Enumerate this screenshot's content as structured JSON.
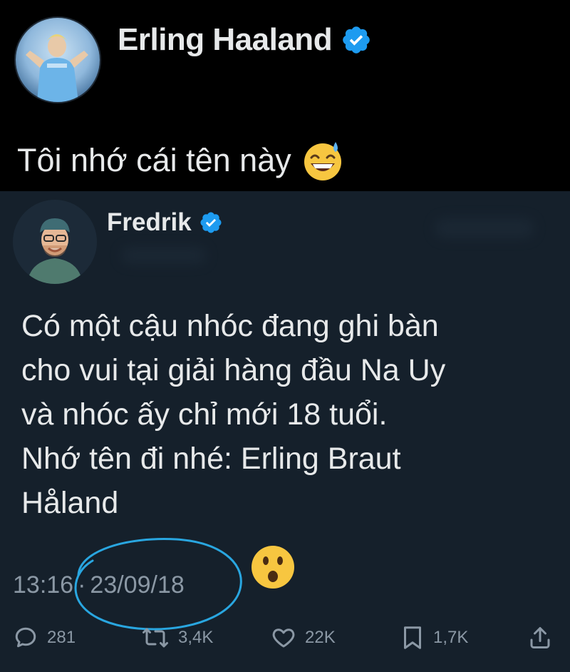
{
  "outer_tweet": {
    "author_name": "Erling Haaland",
    "verified_icon": "verified-badge-icon",
    "avatar_icon": "profile-photo-icon",
    "text": "Tôi nhớ cái tên này",
    "emoji": "grinning-face-with-sweat-emoji"
  },
  "quoted_tweet": {
    "author_name": "Fredrik",
    "verified_icon": "verified-badge-icon",
    "avatar_icon": "profile-photo-icon",
    "body_lines": [
      "Có một cậu nhóc đang ghi bàn",
      "cho vui tại giải hàng đầu Na Uy",
      "và nhóc ấy chỉ mới 18 tuổi.",
      "Nhớ tên đi nhé: Erling Braut",
      "Håland"
    ],
    "time": "13:16",
    "separator": "·",
    "date": "23/09/18",
    "annotation_emoji": "hushed-face-emoji",
    "annotation_circle_color": "#29a6e0"
  },
  "actions": {
    "replies": "281",
    "retweets": "3,4K",
    "likes": "22K",
    "bookmarks": "1,7K"
  },
  "colors": {
    "outer_background": "#000000",
    "inner_background": "#15202b",
    "text_primary": "#e7e9ea",
    "text_secondary": "#8b98a5",
    "verified_blue": "#1d9bf0"
  }
}
